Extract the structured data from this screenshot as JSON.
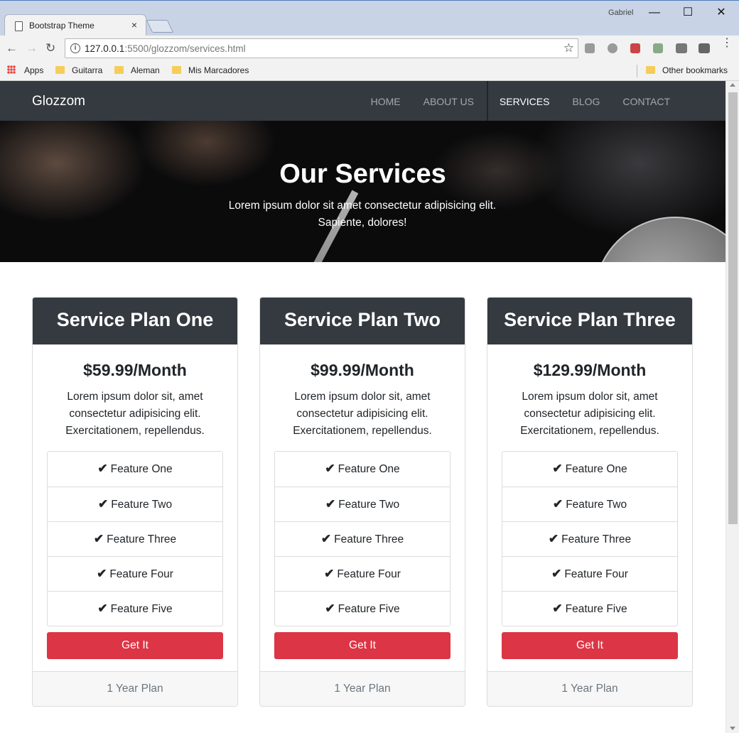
{
  "browser": {
    "tab_title": "Bootstrap Theme",
    "tab_close": "×",
    "profile_name": "Gabriel",
    "url_host": "127.0.0.1",
    "url_path": ":5500/glozzom/services.html",
    "window_controls": {
      "minimize": "—",
      "maximize": "☐",
      "close": "✕"
    },
    "bookmarks": [
      "Apps",
      "Guitarra",
      "Aleman",
      "Mis Marcadores"
    ],
    "other_bookmarks": "Other bookmarks"
  },
  "navbar": {
    "brand": "Glozzom",
    "links": [
      "HOME",
      "ABOUT US",
      "SERVICES",
      "BLOG",
      "CONTACT"
    ],
    "active": "SERVICES"
  },
  "hero": {
    "title": "Our Services",
    "text": "Lorem ipsum dolor sit amet consectetur adipisicing elit. Sapiente, dolores!"
  },
  "plans": [
    {
      "title": "Service Plan One",
      "price": "$59.99/Month",
      "description": "Lorem ipsum dolor sit, amet consectetur adipisicing elit. Exercitationem, repellendus.",
      "features": [
        "Feature One",
        "Feature Two",
        "Feature Three",
        "Feature Four",
        "Feature Five"
      ],
      "button": "Get It",
      "footer": "1 Year Plan"
    },
    {
      "title": "Service Plan Two",
      "price": "$99.99/Month",
      "description": "Lorem ipsum dolor sit, amet consectetur adipisicing elit. Exercitationem, repellendus.",
      "features": [
        "Feature One",
        "Feature Two",
        "Feature Three",
        "Feature Four",
        "Feature Five"
      ],
      "button": "Get It",
      "footer": "1 Year Plan"
    },
    {
      "title": "Service Plan Three",
      "price": "$129.99/Month",
      "description": "Lorem ipsum dolor sit, amet consectetur adipisicing elit. Exercitationem, repellendus.",
      "features": [
        "Feature One",
        "Feature Two",
        "Feature Three",
        "Feature Four",
        "Feature Five"
      ],
      "button": "Get It",
      "footer": "1 Year Plan"
    }
  ],
  "colors": {
    "navbar": "#343a40",
    "button": "#dc3545",
    "footer_bg": "#f7f7f7"
  },
  "icons": {
    "check": "check-icon"
  }
}
